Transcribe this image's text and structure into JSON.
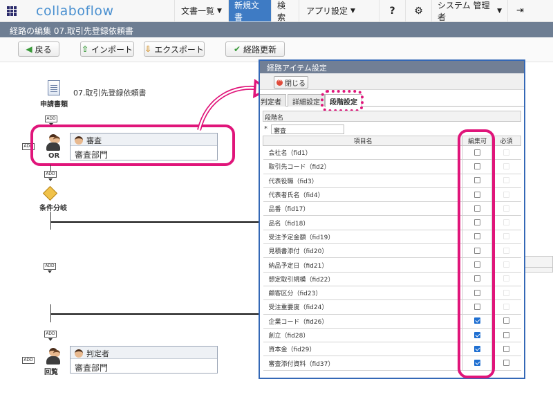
{
  "header": {
    "logo": "collaboflow",
    "nav": {
      "documents": "文書一覧",
      "new_doc": "新規文書",
      "search": "検索",
      "app_settings": "アプリ設定",
      "help": "?",
      "user": "システム 管理者"
    }
  },
  "title_bar": "経路の編集 07.取引先登録依頼書",
  "toolbar": {
    "back": "戻る",
    "import": "インポート",
    "export": "エクスポート",
    "update": "経路更新"
  },
  "flow": {
    "form_name": "07.取引先登録依頼書",
    "form_label": "申請書類",
    "add": "ADD",
    "step1": {
      "label": "OR",
      "title": "審査",
      "dept": "審査部門"
    },
    "branch_label": "条件分岐",
    "step2": {
      "label": "回覧",
      "title": "判定者",
      "dept": "審査部門"
    }
  },
  "dialog": {
    "title": "経路アイテム設定",
    "close": "閉じる",
    "tabs": [
      "判定者",
      "詳細設定",
      "段階設定"
    ],
    "step_name_label": "段階名",
    "step_name_value": "審査",
    "required_mark": "*",
    "columns": [
      "項目名",
      "編集可",
      "必須"
    ],
    "items": [
      {
        "name": "会社名（fid1）",
        "editable": false,
        "required": false
      },
      {
        "name": "取引先コード（fid2）",
        "editable": false,
        "required": false
      },
      {
        "name": "代表役職（fid3）",
        "editable": false,
        "required": false
      },
      {
        "name": "代表者氏名（fid4）",
        "editable": false,
        "required": false
      },
      {
        "name": "品番（fid17）",
        "editable": false,
        "required": false
      },
      {
        "name": "品名（fid18）",
        "editable": false,
        "required": false
      },
      {
        "name": "受注予定金額（fid19）",
        "editable": false,
        "required": false
      },
      {
        "name": "見積書添付（fid20）",
        "editable": false,
        "required": false
      },
      {
        "name": "納品予定日（fid21）",
        "editable": false,
        "required": false
      },
      {
        "name": "想定取引規模（fid22）",
        "editable": false,
        "required": false
      },
      {
        "name": "顧客区分（fid23）",
        "editable": false,
        "required": false
      },
      {
        "name": "受注重要度（fid24）",
        "editable": false,
        "required": false
      },
      {
        "name": "企業コード（fid26）",
        "editable": true,
        "required": false
      },
      {
        "name": "創立（fid28）",
        "editable": true,
        "required": false
      },
      {
        "name": "資本金（fid29）",
        "editable": true,
        "required": false
      },
      {
        "name": "審査添付資料（fid37）",
        "editable": true,
        "required": false
      }
    ]
  },
  "colors": {
    "accent": "#3e7bc4",
    "highlight": "#e0157a",
    "titlebar": "#6e7e93"
  }
}
